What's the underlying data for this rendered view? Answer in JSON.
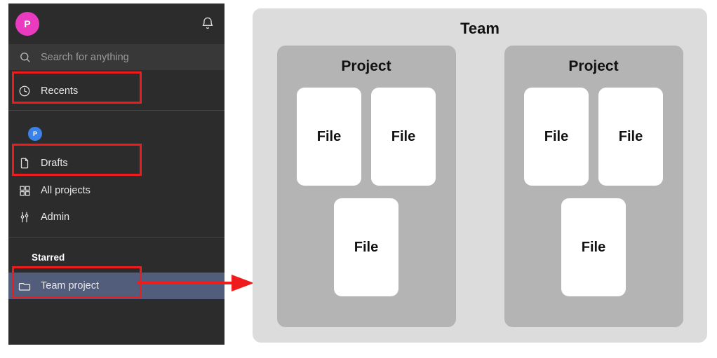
{
  "sidebar": {
    "avatar": {
      "initial": "P",
      "color": "#ea3bc0"
    },
    "bell_icon": "bell-icon",
    "search": {
      "placeholder": "Search for anything",
      "value": "",
      "icon": "search-icon"
    },
    "project_badge": {
      "initial": "P",
      "color": "#3b82e8"
    },
    "starred_header": "Starred",
    "items": [
      {
        "label": "Recents",
        "icon": "clock-icon",
        "highlighted": true
      },
      {
        "label": "Drafts",
        "icon": "document-icon",
        "highlighted": true
      },
      {
        "label": "All projects",
        "icon": "grid-icon",
        "highlighted": false
      },
      {
        "label": "Admin",
        "icon": "sliders-icon",
        "highlighted": false
      },
      {
        "label": "Team project",
        "icon": "folder-icon",
        "highlighted": true,
        "selected": true
      }
    ]
  },
  "annotations": {
    "highlight_color": "#ee1c1c",
    "arrow": "red-arrow-pointing-right"
  },
  "diagram": {
    "team": {
      "label": "Team",
      "color": "#dcdcdc"
    },
    "projects": [
      {
        "label": "Project",
        "color": "#b4b4b4",
        "files_top": [
          {
            "label": "File"
          },
          {
            "label": "File"
          }
        ],
        "files_bottom": [
          {
            "label": "File"
          }
        ]
      },
      {
        "label": "Project",
        "color": "#b4b4b4",
        "files_top": [
          {
            "label": "File"
          },
          {
            "label": "File"
          }
        ],
        "files_bottom": [
          {
            "label": "File"
          }
        ]
      }
    ],
    "file_color": "#ffffff"
  }
}
